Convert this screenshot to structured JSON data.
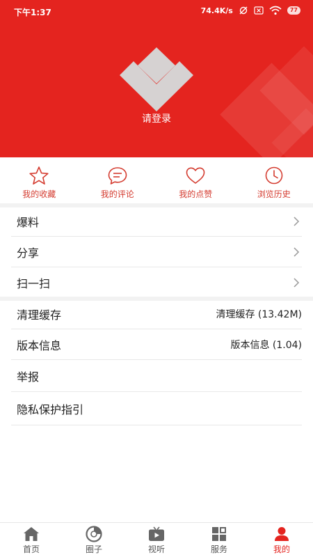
{
  "status_bar": {
    "time": "下午1:37",
    "net_speed": "74.4K/s",
    "battery": "77"
  },
  "profile": {
    "login_label": "请登录"
  },
  "quick_actions": [
    {
      "label": "我的收藏",
      "icon": "star-icon"
    },
    {
      "label": "我的评论",
      "icon": "comment-icon"
    },
    {
      "label": "我的点赞",
      "icon": "heart-icon"
    },
    {
      "label": "浏览历史",
      "icon": "clock-icon"
    }
  ],
  "menu_group1": [
    {
      "label": "爆料"
    },
    {
      "label": "分享"
    },
    {
      "label": "扫一扫"
    }
  ],
  "menu_group2": [
    {
      "label": "清理缓存",
      "value": "清理缓存 (13.42M)"
    },
    {
      "label": "版本信息",
      "value": "版本信息 (1.04)"
    },
    {
      "label": "举报"
    },
    {
      "label": "隐私保护指引"
    }
  ],
  "tabs": [
    {
      "label": "首页",
      "icon": "home-icon"
    },
    {
      "label": "圈子",
      "icon": "circle-icon"
    },
    {
      "label": "视听",
      "icon": "tv-icon"
    },
    {
      "label": "服务",
      "icon": "grid-icon"
    },
    {
      "label": "我的",
      "icon": "user-icon",
      "active": true
    }
  ],
  "colors": {
    "brand_red": "#e4241f",
    "accent_red": "#d43b2f"
  }
}
